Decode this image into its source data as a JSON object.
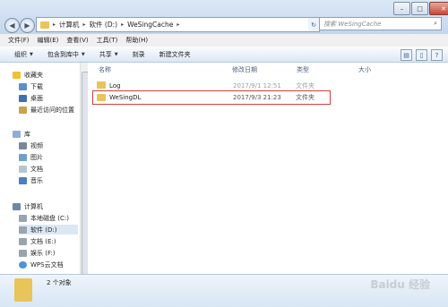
{
  "address": {
    "crumbs": [
      "计算机",
      "软件 (D:)",
      "WeSingCache"
    ]
  },
  "search": {
    "placeholder": "搜索 WeSingCache"
  },
  "menu": [
    "文件(F)",
    "编辑(E)",
    "查看(V)",
    "工具(T)",
    "帮助(H)"
  ],
  "toolbar": [
    "组织",
    "包含到库中",
    "共享",
    "刻录",
    "新建文件夹"
  ],
  "nav": {
    "favorites": "收藏夹",
    "fav_items": [
      "下载",
      "桌面",
      "最近访问的位置"
    ],
    "libraries": "库",
    "lib_items": [
      "视频",
      "图片",
      "文档",
      "音乐"
    ],
    "computer": "计算机",
    "comp_items": [
      "本地磁盘 (C:)",
      "软件 (D:)",
      "文档 (E:)",
      "娱乐 (F:)",
      "WPS云文档"
    ]
  },
  "columns": [
    "名称",
    "修改日期",
    "类型",
    "大小"
  ],
  "files": [
    {
      "name": "Log",
      "date": "2017/9/1 12:51",
      "type": "文件夹"
    },
    {
      "name": "WeSingDL",
      "date": "2017/9/3 21:23",
      "type": "文件夹"
    }
  ],
  "status": {
    "count": "2 个对象"
  },
  "watermark": "Baidu 经验",
  "colors": {
    "folder": "#e8c45a",
    "highlight": "#d2403a"
  }
}
